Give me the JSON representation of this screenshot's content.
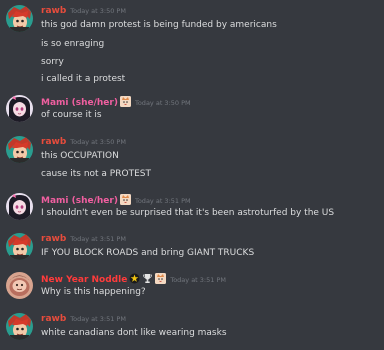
{
  "colors": {
    "background": "#36393f",
    "rawb": "#e74c3c",
    "mami": "#f05fa0",
    "new_year_noddle": "#ff3b3b",
    "timestamp": "#72767d",
    "text": "#dcddde"
  },
  "messages": [
    {
      "author": "rawb",
      "timestamp": "Today at 3:50 PM",
      "lines": [
        "this god damn protest is being funded by americans",
        "is so enraging",
        "sorry",
        "i called it a protest"
      ]
    },
    {
      "author": "Mami (she/her)",
      "timestamp": "Today at 3:50 PM",
      "lines": [
        "of course it is"
      ]
    },
    {
      "author": "rawb",
      "timestamp": "Today at 3:50 PM",
      "lines": [
        "this OCCUPATION",
        "cause its not a PROTEST"
      ]
    },
    {
      "author": "Mami (she/her)",
      "timestamp": "Today at 3:51 PM",
      "lines": [
        "I shouldn't even be surprised that it's been astroturfed by the US"
      ]
    },
    {
      "author": "rawb",
      "timestamp": "Today at 3:51 PM",
      "lines": [
        "IF YOU BLOCK ROADS and bring GIANT TRUCKS"
      ]
    },
    {
      "author": "New Year Noddle",
      "timestamp": "Today at 3:51 PM",
      "lines": [
        "Why is this happening?"
      ]
    },
    {
      "author": "rawb",
      "timestamp": "Today at 3:51 PM",
      "lines": [
        "white canadians dont like wearing masks"
      ]
    }
  ]
}
